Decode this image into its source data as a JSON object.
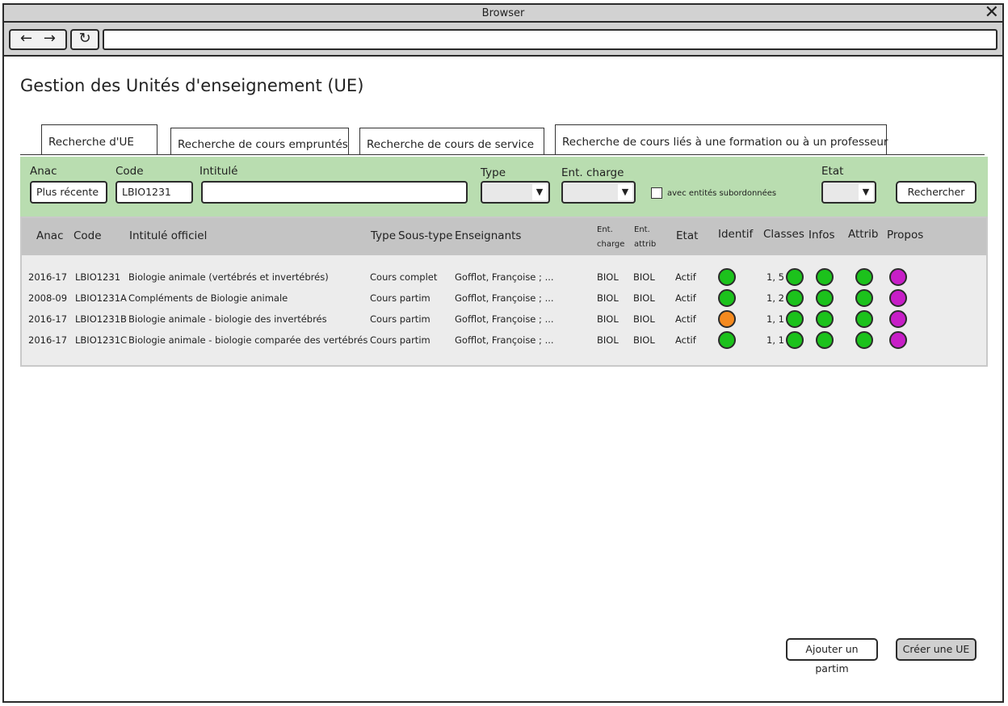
{
  "browser": {
    "title": "Browser",
    "back": "←",
    "forward": "→",
    "reload": "↻",
    "close": "✕"
  },
  "page": {
    "title": "Gestion des Unités d'enseignement (UE)"
  },
  "tabs": [
    "Recherche d'UE",
    "Recherche de cours empruntés",
    "Recherche de cours de service",
    "Recherche de cours liés à une formation ou à un professeur"
  ],
  "filters": {
    "anac_label": "Anac",
    "anac_value": "Plus récente",
    "code_label": "Code",
    "code_value": "LBIO1231",
    "intitule_label": "Intitulé",
    "intitule_value": "",
    "type_label": "Type",
    "ent_charge_label": "Ent. charge",
    "subentities_label": "avec entités subordonnées",
    "etat_label": "Etat",
    "search_button": "Rechercher"
  },
  "table": {
    "headers": {
      "anac": "Anac",
      "code": "Code",
      "intitule": "Intitulé officiel",
      "type": "Type",
      "soustype": "Sous-type",
      "enseignants": "Enseignants",
      "ent_charge_1": "Ent.",
      "ent_charge_2": "charge",
      "ent_attrib_1": "Ent.",
      "ent_attrib_2": "attrib",
      "etat": "Etat",
      "identif": "Identif",
      "classes": "Classes",
      "infos": "Infos",
      "attrib": "Attrib",
      "propos": "Propos"
    },
    "rows": [
      {
        "anac": "2016-17",
        "code": "LBIO1231",
        "intitule": "Biologie animale (vertébrés et invertébrés)",
        "type": "Cours complet",
        "enseignants": "Gofflot, Françoise ; ...",
        "ent_charge": "BIOL",
        "ent_attrib": "BIOL",
        "etat": "Actif",
        "classes": "1, 5",
        "identif_color": "#1cc21c",
        "classes_color": "#1cc21c",
        "infos_color": "#1cc21c",
        "attrib_color": "#1cc21c",
        "propos_color": "#c71ec7"
      },
      {
        "anac": "2008-09",
        "code": "LBIO1231A",
        "intitule": "Compléments de Biologie animale",
        "type": "Cours partim",
        "enseignants": "Gofflot, Françoise ; ...",
        "ent_charge": "BIOL",
        "ent_attrib": "BIOL",
        "etat": "Actif",
        "classes": "1, 2",
        "identif_color": "#1cc21c",
        "classes_color": "#1cc21c",
        "infos_color": "#1cc21c",
        "attrib_color": "#1cc21c",
        "propos_color": "#c71ec7"
      },
      {
        "anac": "2016-17",
        "code": "LBIO1231B",
        "intitule": "Biologie animale - biologie des invertébrés",
        "type": "Cours partim",
        "enseignants": "Gofflot, Françoise ; ...",
        "ent_charge": "BIOL",
        "ent_attrib": "BIOL",
        "etat": "Actif",
        "classes": "1, 1",
        "identif_color": "#f58a1f",
        "classes_color": "#1cc21c",
        "infos_color": "#1cc21c",
        "attrib_color": "#1cc21c",
        "propos_color": "#c71ec7"
      },
      {
        "anac": "2016-17",
        "code": "LBIO1231C",
        "intitule": "Biologie animale - biologie comparée des vertébrés",
        "type": "Cours partim",
        "enseignants": "Gofflot, Françoise ; ...",
        "ent_charge": "BIOL",
        "ent_attrib": "BIOL",
        "etat": "Actif",
        "classes": "1, 1",
        "identif_color": "#1cc21c",
        "classes_color": "#1cc21c",
        "infos_color": "#1cc21c",
        "attrib_color": "#1cc21c",
        "propos_color": "#c71ec7"
      }
    ]
  },
  "actions": {
    "add_partim": "Ajouter un partim",
    "create_ue": "Créer une UE"
  }
}
